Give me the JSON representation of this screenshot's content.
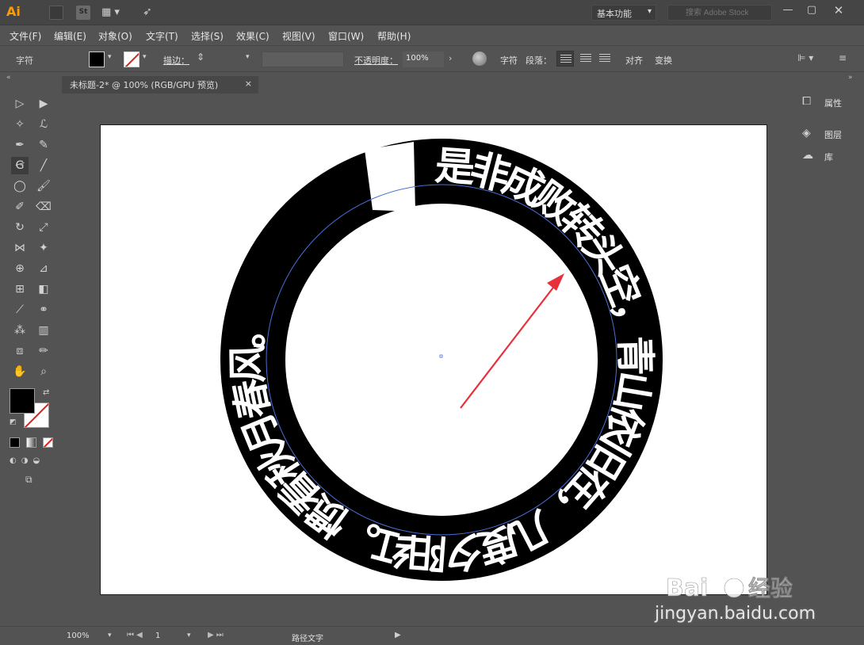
{
  "titlebar": {
    "app_logo": "Ai",
    "stock_icon": "St",
    "workspace": "基本功能",
    "search_placeholder": "搜索 Adobe Stock"
  },
  "menu": [
    "文件(F)",
    "编辑(E)",
    "对象(O)",
    "文字(T)",
    "选择(S)",
    "效果(C)",
    "视图(V)",
    "窗口(W)",
    "帮助(H)"
  ],
  "control_bar": {
    "context_label": "字符",
    "stroke_label": "描边：",
    "opacity_label": "不透明度：",
    "opacity_value": "100%",
    "character_link": "字符",
    "paragraph_link": "段落：",
    "align_link": "对齐",
    "transform_link": "变换"
  },
  "document_tab": {
    "title": "未标题-2* @ 100% (RGB/GPU 预览)",
    "close": "×"
  },
  "panels": {
    "properties": "属性",
    "layers": "图层",
    "libraries": "库"
  },
  "artwork": {
    "path_text": "是非成败转头空，青山依旧在，几度夕阳红。惯看秋月春风。",
    "annotation_color": "#e8303a",
    "path_color": "#4a6fd8"
  },
  "status_bar": {
    "zoom": "100%",
    "artboard": "1",
    "tool": "路径文字"
  },
  "watermark": {
    "logo_left": "Bai",
    "logo_right": "经验",
    "url": "jingyan.baidu.com"
  }
}
